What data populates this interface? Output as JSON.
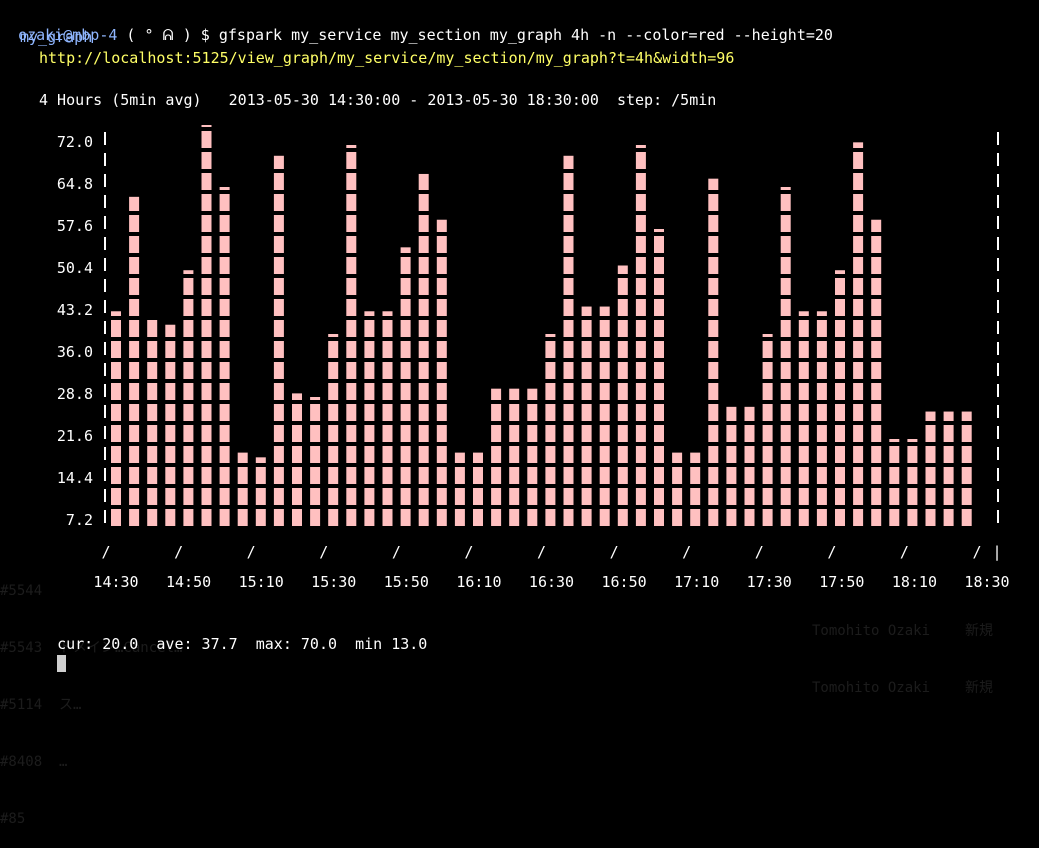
{
  "terminal": {
    "prompt_user": "ozaki@mbp-4",
    "prompt_face": " ( ° ᕱ ) $ ",
    "command": "gfspark my_service my_section my_graph 4h -n --color=red --height=20"
  },
  "graph": {
    "name": "my_graph",
    "url": "http://localhost:5125/view_graph/my_service/my_section/my_graph?t=4h&width=96",
    "range_line": "4 Hours (5min avg)   2013-05-30 14:30:00 - 2013-05-30 18:30:00  step: /5min",
    "stats_line": "cur: 20.0  ave: 37.7  max: 70.0  min 13.0"
  },
  "background_text": {
    "rows": [
      "#5544",
      "#5543  ドメイン…Cancel…",
      "#5114  ス…",
      "#8408  …",
      "#85"
    ],
    "right": [
      "Tomohito Ozaki",
      "新規",
      "Tomohito Ozaki",
      "新規"
    ]
  },
  "colors": {
    "bar": "#ffc0c0",
    "axis_text": "#ffffff",
    "prompt_user": "#8fb6ff",
    "url": "#ffff66"
  },
  "chart_data": {
    "type": "bar",
    "ylim": [
      0,
      72
    ],
    "yticks": [
      "72.0",
      "64.8",
      "57.6",
      "50.4",
      "43.2",
      "36.0",
      "28.8",
      "21.6",
      "14.4",
      "7.2"
    ],
    "xticks": [
      "14:30",
      "14:50",
      "15:10",
      "15:30",
      "15:50",
      "16:10",
      "16:30",
      "16:50",
      "17:10",
      "17:30",
      "17:50",
      "18:10",
      "18:30"
    ],
    "values": [
      37,
      57,
      36,
      35,
      44,
      70,
      58,
      13,
      12,
      64,
      23,
      22,
      33,
      65,
      37,
      37,
      48,
      61,
      53,
      13,
      13,
      24,
      24,
      24,
      33,
      64,
      38,
      38,
      45,
      65,
      51,
      13,
      13,
      60,
      21,
      21,
      33,
      58,
      37,
      37,
      44,
      66,
      53,
      15,
      15,
      20,
      20,
      20
    ]
  }
}
